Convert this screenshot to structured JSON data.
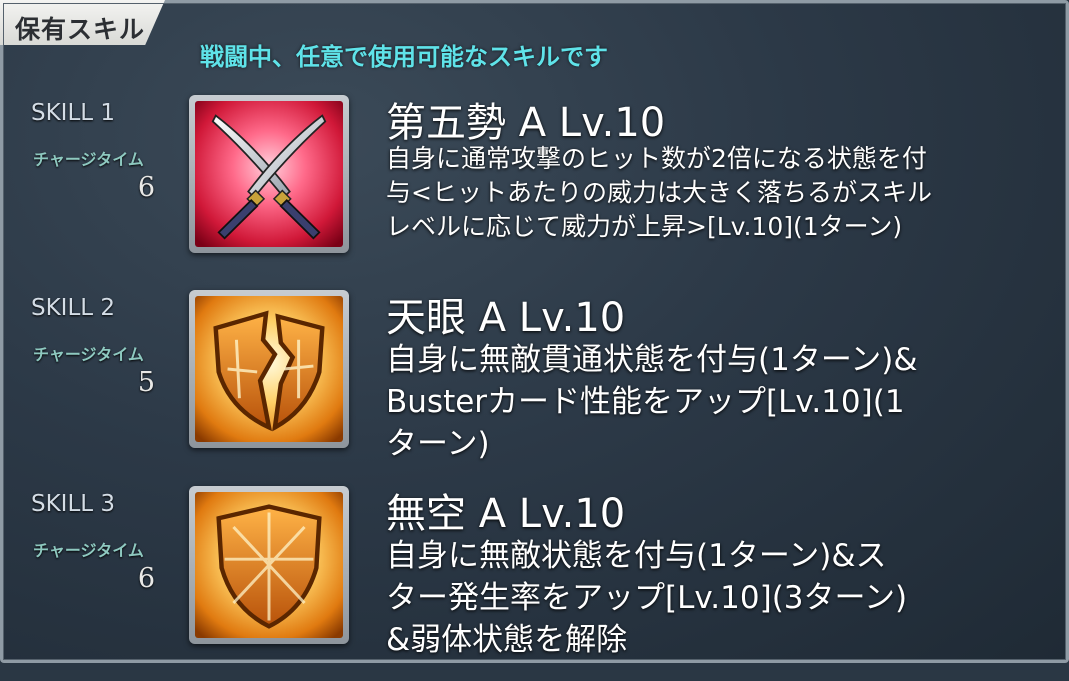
{
  "header": {
    "title": "保有スキル",
    "subtitle": "戦闘中、任意で使用可能なスキルです"
  },
  "skills": [
    {
      "slot_label": "SKILL 1",
      "charge_label": "チャージタイム",
      "charge_value": "6",
      "name": "第五勢 A Lv.10",
      "icon": "crossed-swords-icon",
      "desc_lines": [
        "自身に通常攻撃のヒット数が2倍になる状態を付",
        "与<ヒットあたりの威力は大きく落ちるがスキル",
        "レベルに応じて威力が上昇>[Lv.10](1ターン)"
      ]
    },
    {
      "slot_label": "SKILL 2",
      "charge_label": "チャージタイム",
      "charge_value": "5",
      "name": "天眼 A Lv.10",
      "icon": "broken-shield-icon",
      "desc_lines": [
        "自身に無敵貫通状態を付与(1ターン)&",
        "Busterカード性能をアップ[Lv.10](1",
        "ターン)"
      ]
    },
    {
      "slot_label": "SKILL 3",
      "charge_label": "チャージタイム",
      "charge_value": "6",
      "name": "無空 A Lv.10",
      "icon": "shield-icon",
      "desc_lines": [
        "自身に無敵状態を付与(1ターン)&ス",
        "ター発生率をアップ[Lv.10](3ターン)",
        "&弱体状態を解除"
      ]
    }
  ]
}
